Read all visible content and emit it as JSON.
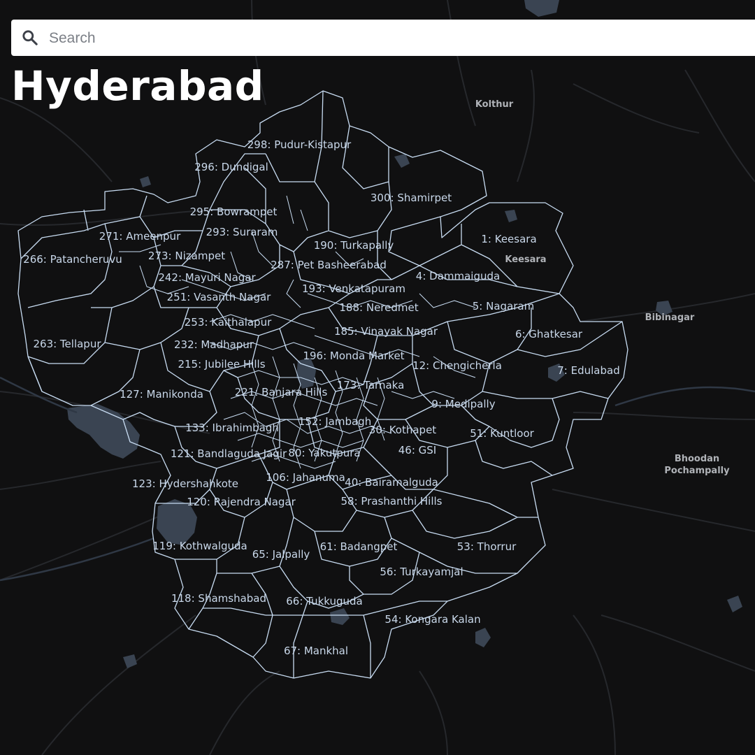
{
  "search": {
    "placeholder": "Search",
    "icon": "search-icon"
  },
  "city": {
    "title": "Hyderabad"
  },
  "colors": {
    "background": "#101011",
    "boundary": "#c8dcf2",
    "water": "#3a4452",
    "road": "#2a2c30"
  },
  "wards": [
    "298: Pudur-Kistapur",
    "296: Dundigal",
    "300: Shamirpet",
    "295: Bowrampet",
    "293: Suraram",
    "271: Ameenpur",
    "1: Keesara",
    "190: Turkapally",
    "273: Nizampet",
    "266: Patancheruvu",
    "287: Pet Basheerabad",
    "242: Mayuri Nagar",
    "4: Dammaiguda",
    "193: Venkatapuram",
    "251: Vasanth Nagar",
    "188: Neredmet",
    "5: Nagaram",
    "253: Kaithalapur",
    "185: Vinayak Nagar",
    "6: Ghatkesar",
    "263: Tellapur",
    "232: Madhapur",
    "196: Monda Market",
    "215: Jubilee Hills",
    "12: Chengicherla",
    "7: Edulabad",
    "173: Tarnaka",
    "127: Manikonda",
    "221: Banjara Hills",
    "9: Medipally",
    "152: Jambagh",
    "133: Ibrahimbagh",
    "30: Kothapet",
    "51: Kuntloor",
    "121: Bandlaguda Jagir",
    "80: Yakutpura",
    "46: GSI",
    "106: Jahanuma",
    "123: Hydershahkote",
    "40: Bairamalguda",
    "120: Rajendra Nagar",
    "58: Prashanthi Hills",
    "119: Kothwalguda",
    "61: Badangpet",
    "53: Thorrur",
    "65: Jalpally",
    "56: Turkayamjal",
    "118: Shamshabad",
    "66: Tukkuguda",
    "54: Kongara Kalan",
    "67: Mankhal"
  ],
  "places": [
    "Kolthur",
    "Keesara",
    "Bibinagar",
    "Bhoodan",
    "Pochampally"
  ]
}
